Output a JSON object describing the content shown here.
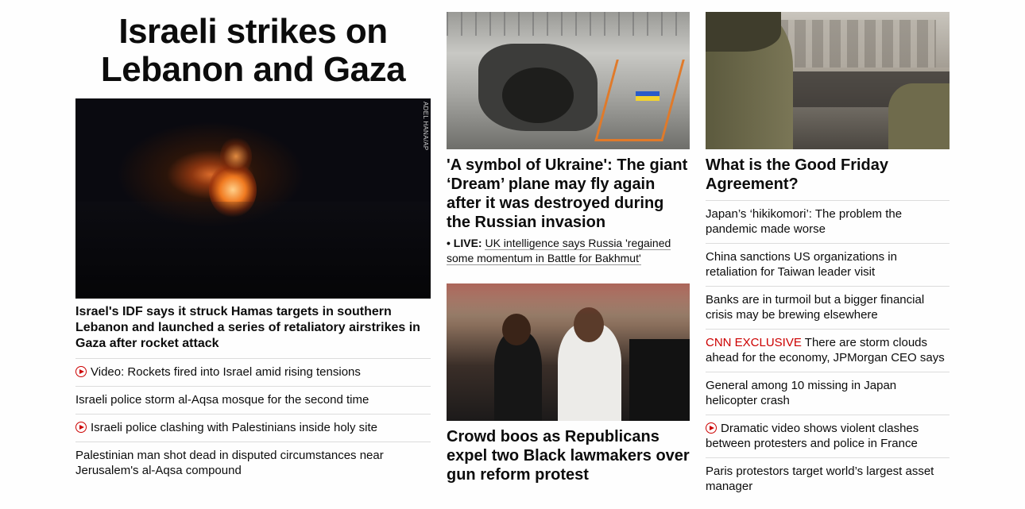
{
  "col1": {
    "headline": "Israeli strikes on Lebanon and Gaza",
    "image_credit": "ADEL HANA/AP",
    "lead": "Israel's IDF says it struck Hamas targets in southern Lebanon and launched a series of retaliatory airstrikes in Gaza after rocket attack",
    "links": [
      {
        "text": "Video: Rockets fired into Israel amid rising tensions",
        "video": true
      },
      {
        "text": "Israeli police storm al-Aqsa mosque for the second time",
        "video": false
      },
      {
        "text": "Israeli police clashing with Palestinians inside holy site",
        "video": true
      },
      {
        "text": "Palestinian man shot dead in disputed circumstances near Jerusalem's al-Aqsa compound",
        "video": false
      }
    ]
  },
  "col2": {
    "card1": {
      "title": "'A symbol of Ukraine': The giant ‘Dream’ plane may fly again after it was destroyed during the Russian invasion",
      "live_label": "• LIVE:",
      "live_text": "UK intelligence says Russia 'regained some momentum in Battle for Bakhmut'"
    },
    "card2": {
      "title": "Crowd boos as Republicans expel two Black lawmakers over gun reform protest"
    }
  },
  "col3": {
    "card_title": "What is the Good Friday Agreement?",
    "links": [
      {
        "kicker": "",
        "text": "Japan’s ‘hikikomori’: The problem the pandemic made worse",
        "video": false
      },
      {
        "kicker": "",
        "text": "China sanctions US organizations in retaliation for Taiwan leader visit",
        "video": false
      },
      {
        "kicker": "",
        "text": "Banks are in turmoil but a bigger financial crisis may be brewing elsewhere",
        "video": false
      },
      {
        "kicker": "CNN EXCLUSIVE",
        "text": "There are storm clouds ahead for the economy, JPMorgan CEO says",
        "video": false
      },
      {
        "kicker": "",
        "text": "General among 10 missing in Japan helicopter crash",
        "video": false
      },
      {
        "kicker": "",
        "text": "Dramatic video shows violent clashes between protesters and police in France",
        "video": true
      },
      {
        "kicker": "",
        "text": "Paris protestors target world’s largest asset manager",
        "video": false
      }
    ]
  },
  "colors": {
    "accent_red": "#cc0000",
    "divider": "#dcdcdc"
  },
  "icons": {
    "video": "play-circle-icon"
  }
}
